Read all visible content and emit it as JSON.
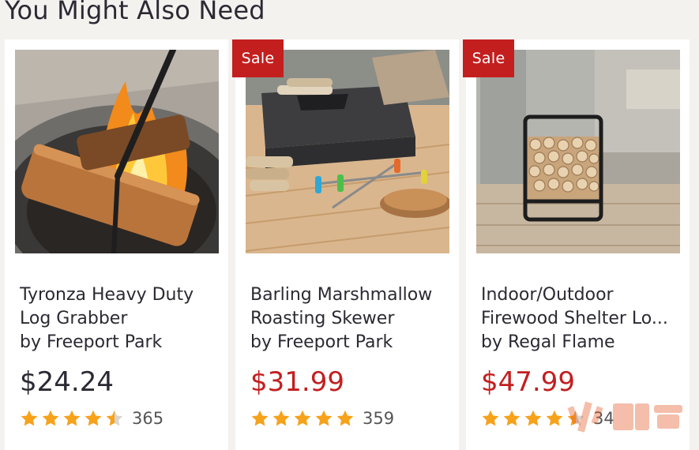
{
  "section": {
    "title": "You Might Also Need"
  },
  "colors": {
    "star": "#f7a21b",
    "sale": "#c31f1f",
    "text": "#2b2a33"
  },
  "watermark": "火鲤鱼",
  "products": [
    {
      "name_line1": "Tyronza Heavy Duty",
      "name_line2": "Log Grabber",
      "brand": "by Freeport Park",
      "price": "$24.24",
      "on_sale": false,
      "sale_label": "",
      "rating": 4.5,
      "review_count": "365",
      "image": "log-grabber-fire-pit-photo"
    },
    {
      "name_line1": "Barling Marshmallow",
      "name_line2": "Roasting Skewer",
      "brand": "by Freeport Park",
      "price": "$31.99",
      "on_sale": true,
      "sale_label": "Sale",
      "rating": 5,
      "review_count": "359",
      "image": "roasting-skewer-patio-photo"
    },
    {
      "name_line1": "Indoor/Outdoor",
      "name_line2": "Firewood Shelter Lo...",
      "brand": "by Regal Flame",
      "price": "$47.99",
      "on_sale": true,
      "sale_label": "Sale",
      "rating": 4.5,
      "review_count": "34",
      "image": "firewood-rack-photo"
    }
  ]
}
